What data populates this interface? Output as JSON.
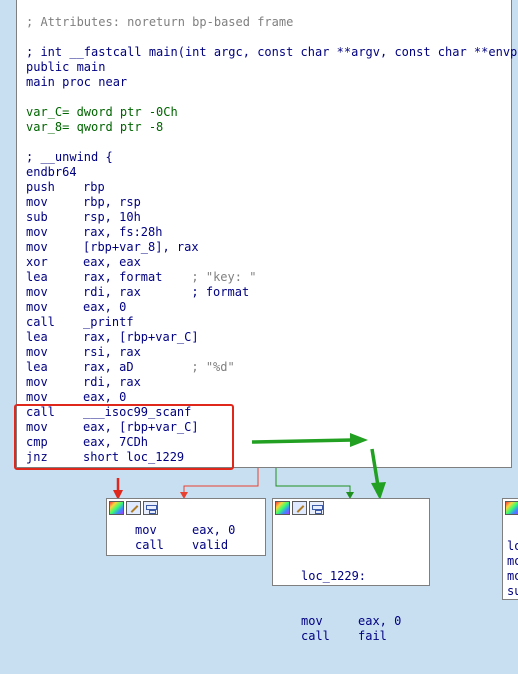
{
  "main_block": {
    "lines": [
      {
        "type": "comment",
        "text": "; Attributes: noreturn bp-based frame"
      },
      {
        "type": "blank"
      },
      {
        "type": "proto",
        "text": "; int __fastcall main(int argc, const char **argv, const char **envp)"
      },
      {
        "type": "plain",
        "text": "public main"
      },
      {
        "type": "plain",
        "text": "main proc near"
      },
      {
        "type": "blank"
      },
      {
        "type": "var",
        "text": "var_C= dword ptr -0Ch"
      },
      {
        "type": "var",
        "text": "var_8= qword ptr -8"
      },
      {
        "type": "blank"
      },
      {
        "type": "plain",
        "text": "; __unwind {"
      },
      {
        "type": "plain",
        "text": "endbr64"
      },
      {
        "type": "ins",
        "mn": "push",
        "ops": "rbp"
      },
      {
        "type": "ins",
        "mn": "mov",
        "ops": "rbp, rsp"
      },
      {
        "type": "ins",
        "mn": "sub",
        "ops": "rsp, 10h"
      },
      {
        "type": "ins",
        "mn": "mov",
        "ops": "rax, fs:28h"
      },
      {
        "type": "ins",
        "mn": "mov",
        "ops": "[rbp+var_8], rax"
      },
      {
        "type": "ins",
        "mn": "xor",
        "ops": "eax, eax"
      },
      {
        "type": "ins",
        "mn": "lea",
        "ops": "rax, format",
        "comment": "; \"key: \""
      },
      {
        "type": "ins",
        "mn": "mov",
        "ops": "rdi, rax",
        "comment": "; format"
      },
      {
        "type": "ins",
        "mn": "mov",
        "ops": "eax, 0"
      },
      {
        "type": "ins",
        "mn": "call",
        "ops": "_printf"
      },
      {
        "type": "ins",
        "mn": "lea",
        "ops": "rax, [rbp+var_C]"
      },
      {
        "type": "ins",
        "mn": "mov",
        "ops": "rsi, rax"
      },
      {
        "type": "ins",
        "mn": "lea",
        "ops": "rax, aD",
        "comment": "; \"%d\""
      },
      {
        "type": "ins",
        "mn": "mov",
        "ops": "rdi, rax"
      },
      {
        "type": "ins",
        "mn": "mov",
        "ops": "eax, 0"
      },
      {
        "type": "ins",
        "mn": "call",
        "ops": "___isoc99_scanf"
      },
      {
        "type": "ins",
        "mn": "mov",
        "ops": "eax, [rbp+var_C]"
      },
      {
        "type": "ins",
        "mn": "cmp",
        "ops": "eax, 7CDh"
      },
      {
        "type": "ins",
        "mn": "jnz",
        "ops": "short loc_1229"
      }
    ]
  },
  "node_valid": {
    "lines": [
      {
        "mn": "mov",
        "ops": "eax, 0"
      },
      {
        "mn": "call",
        "ops": "valid"
      }
    ]
  },
  "node_fail": {
    "label": "loc_1229:",
    "lines": [
      {
        "mn": "mov",
        "ops": "eax, 0"
      },
      {
        "mn": "call",
        "ops": "fail"
      }
    ]
  },
  "node_right": {
    "lines": [
      "lo",
      "mo",
      "mo",
      "su"
    ]
  },
  "colors": {
    "background": "#c8dff2",
    "highlight_box": "#e0271c",
    "arrow_green": "#22a022",
    "edge_red": "#e8412f",
    "edge_green": "#1f8f1f"
  }
}
